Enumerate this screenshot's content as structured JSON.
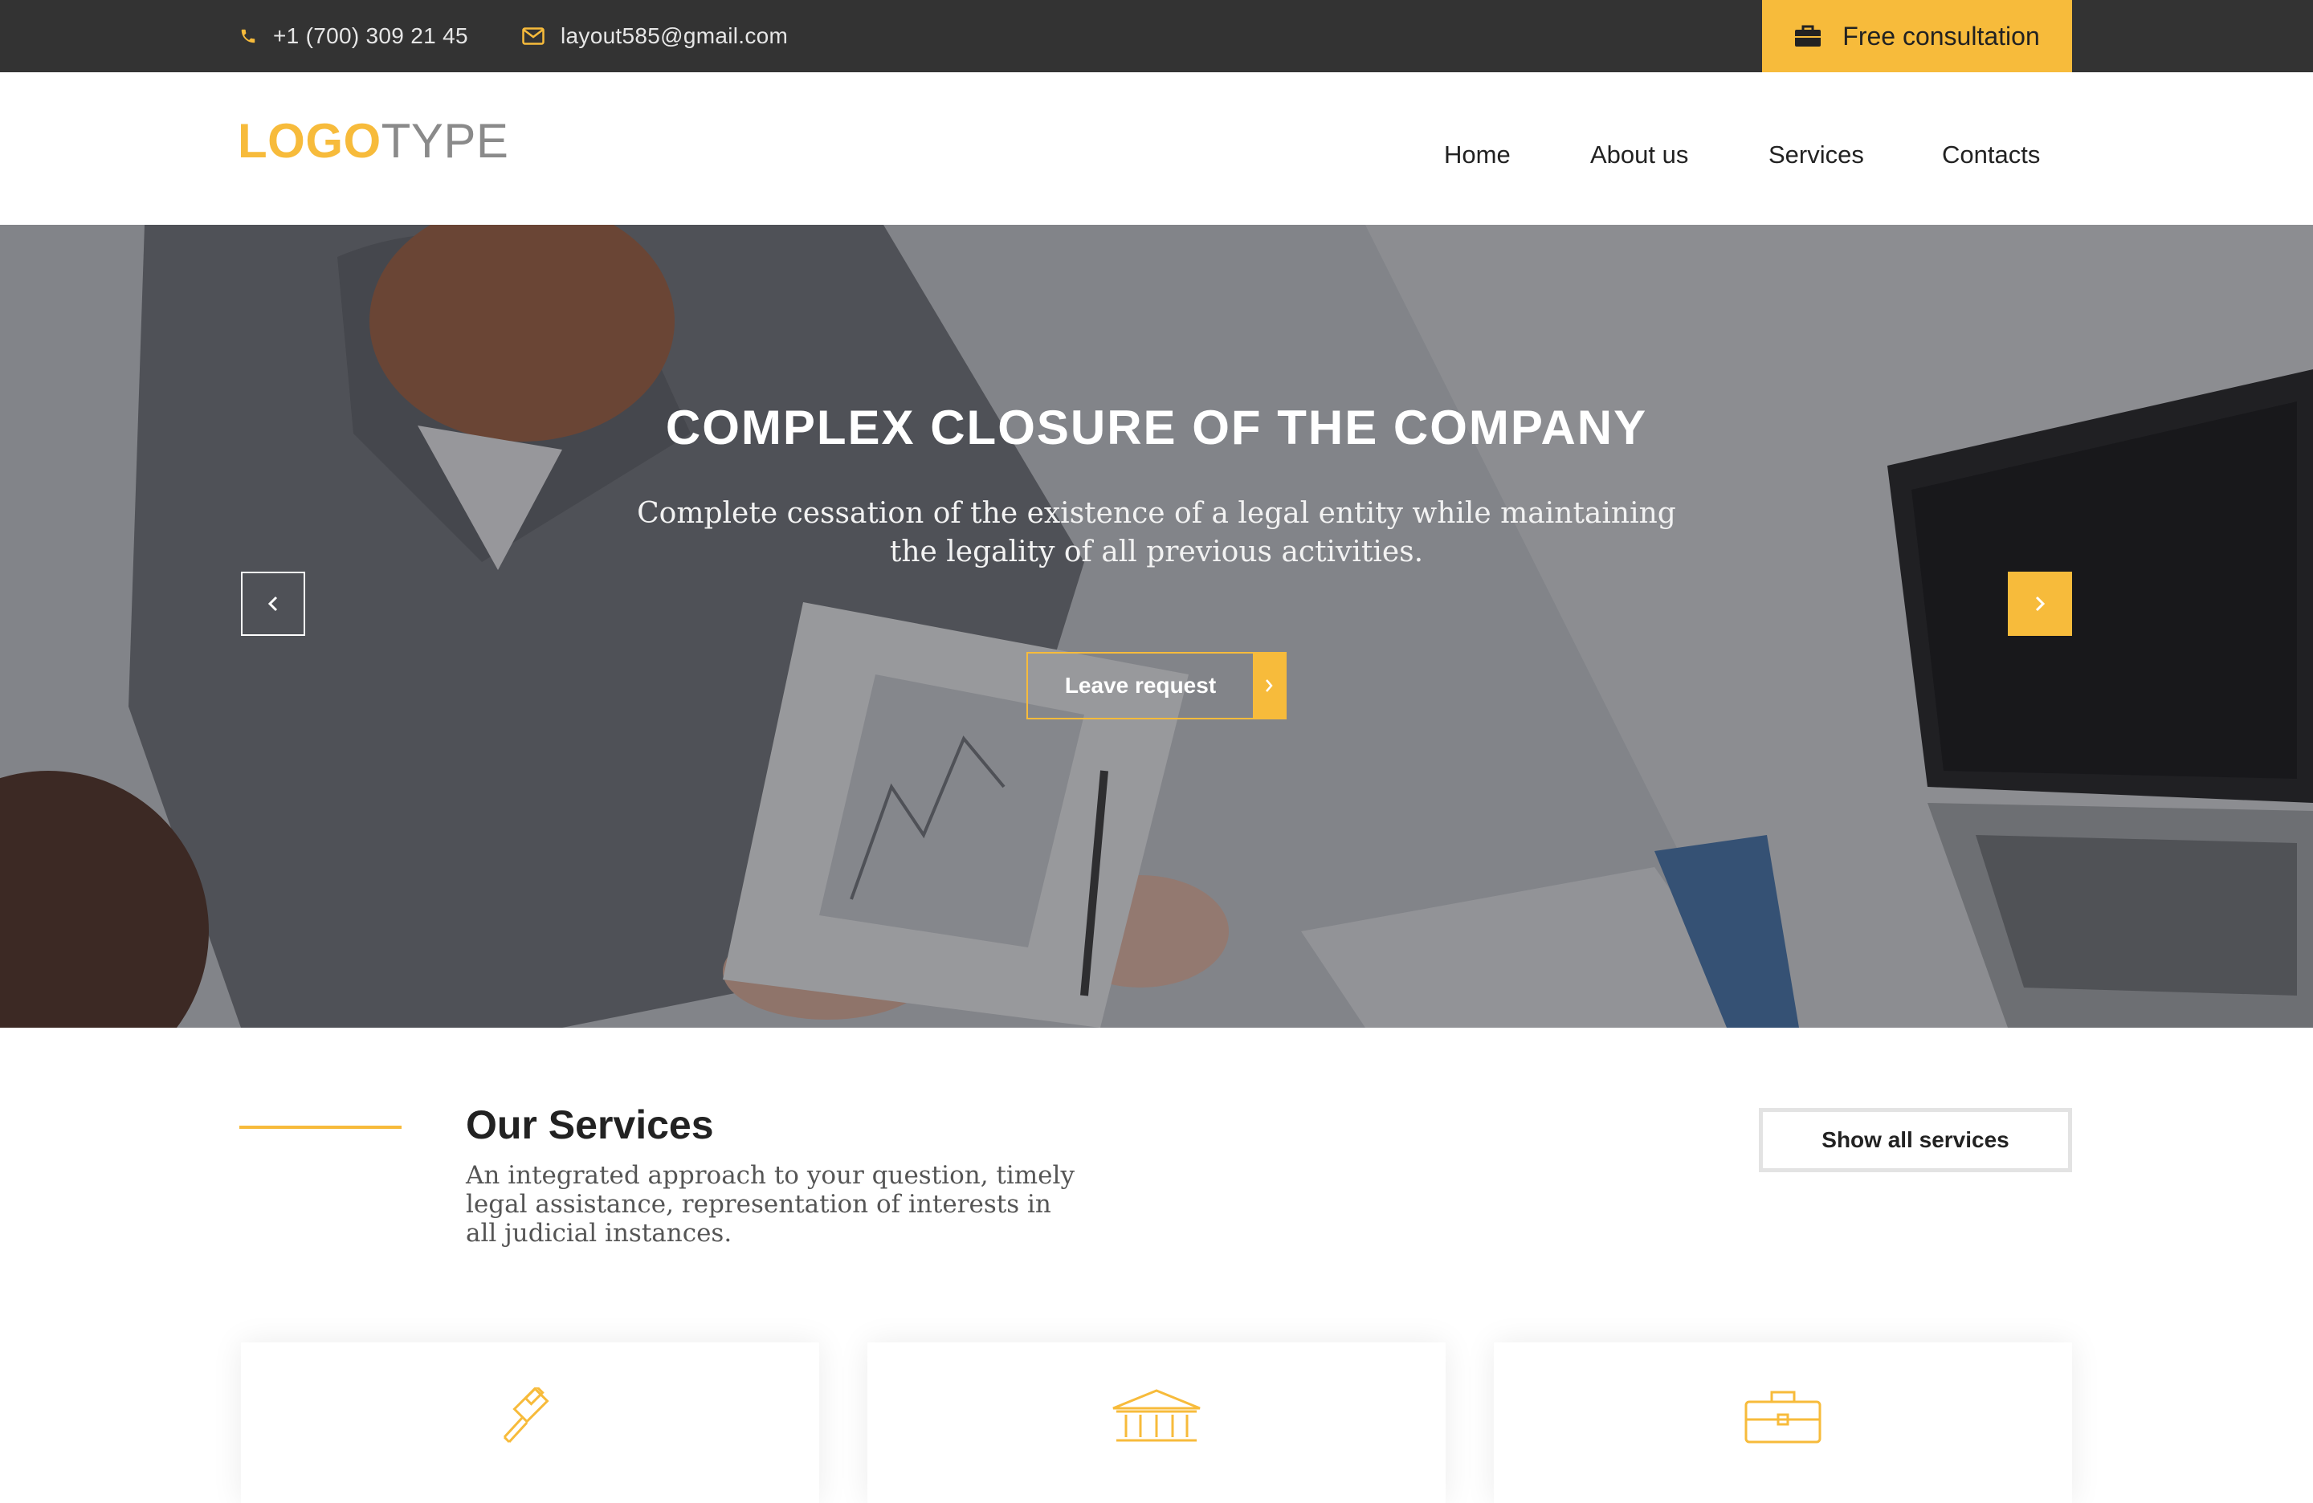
{
  "topbar": {
    "phone": "+1 (700) 309 21 45",
    "email": "layout585@gmail.com",
    "consult_label": "Free consultation",
    "icons": {
      "phone": "phone-icon",
      "email": "envelope-icon",
      "consult": "briefcase-icon"
    }
  },
  "header": {
    "logo_part1": "LOGO",
    "logo_part2": "TYPE",
    "nav": [
      {
        "label": "Home"
      },
      {
        "label": "About us"
      },
      {
        "label": "Services"
      },
      {
        "label": "Contacts"
      }
    ]
  },
  "hero": {
    "title": "COMPLEX CLOSURE OF THE COMPANY",
    "subtitle": "Complete cessation of the existence of a legal entity while maintaining the legality of all previous activities.",
    "cta_label": "Leave request"
  },
  "services": {
    "title": "Our Services",
    "description": "An integrated approach to your question, timely legal assistance, representation of interests in all judicial instances.",
    "show_all_label": "Show all services",
    "cards": [
      {
        "icon": "gavel-icon"
      },
      {
        "icon": "courthouse-icon"
      },
      {
        "icon": "briefcase-icon"
      }
    ]
  },
  "colors": {
    "accent": "#f7bb3b",
    "topbar_bg": "#333333",
    "text_dark": "#222222"
  }
}
